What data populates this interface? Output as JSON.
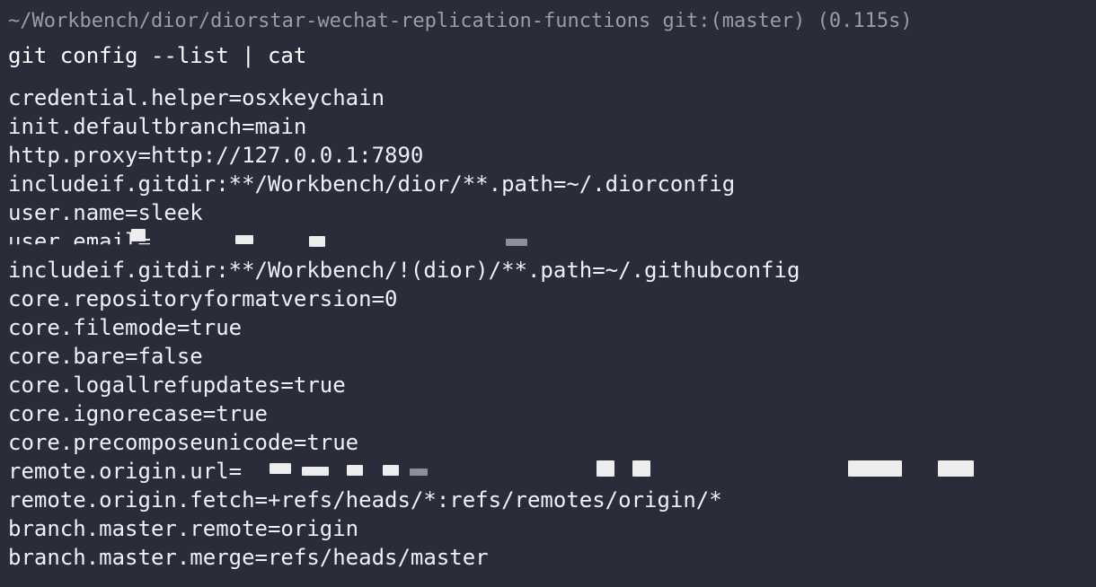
{
  "terminal": {
    "prompt": "~/Workbench/dior/diorstar-wechat-replication-functions git:(master) (0.115s)",
    "command": "git config --list | cat",
    "lines": [
      "credential.helper=osxkeychain",
      "init.defaultbranch=main",
      "http.proxy=http://127.0.0.1:7890",
      "includeif.gitdir:**/Workbench/dior/**.path=~/.diorconfig",
      "user.name=sleek",
      "user.email=",
      "includeif.gitdir:**/Workbench/!(dior)/**.path=~/.githubconfig",
      "core.repositoryformatversion=0",
      "core.filemode=true",
      "core.bare=false",
      "core.logallrefupdates=true",
      "core.ignorecase=true",
      "core.precomposeunicode=true",
      "remote.origin.url=",
      "remote.origin.fetch=+refs/heads/*:refs/remotes/origin/*",
      "branch.master.remote=origin",
      "branch.master.merge=refs/heads/master"
    ]
  },
  "colors": {
    "background": "#2a2d39",
    "prompt": "#9a9da8",
    "text": "#f0f1f5"
  }
}
